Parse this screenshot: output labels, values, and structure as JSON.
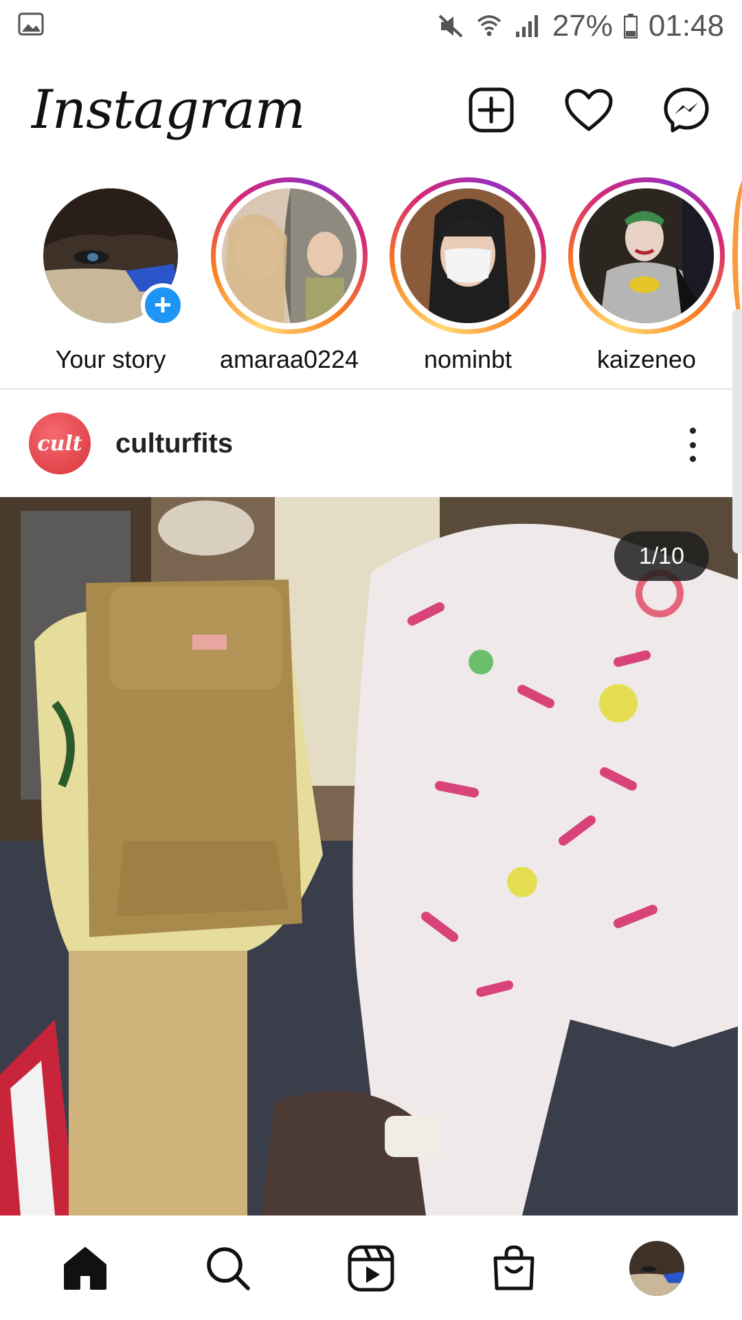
{
  "status_bar": {
    "battery": "27%",
    "time": "01:48",
    "icons": [
      "image-icon",
      "mute-icon",
      "wifi-icon",
      "signal-icon",
      "battery-icon"
    ]
  },
  "header": {
    "logo": "Instagram",
    "actions": [
      "new-post-icon",
      "heart-icon",
      "messenger-icon"
    ]
  },
  "stories": [
    {
      "label": "Your story",
      "own": true
    },
    {
      "label": "amaraa0224"
    },
    {
      "label": "nominbt"
    },
    {
      "label": "kaizeneo"
    }
  ],
  "post": {
    "avatar_text": "cult",
    "username": "culturfits",
    "counter": "1/10"
  },
  "bottom_nav": [
    "home-icon",
    "search-icon",
    "reels-icon",
    "shop-icon",
    "profile-avatar"
  ],
  "colors": {
    "accent_blue": "#1e95f5",
    "story_ring": [
      "#feda75",
      "#fa7e1e",
      "#d62976",
      "#962fbf"
    ],
    "brand_red": "#d8353c"
  }
}
